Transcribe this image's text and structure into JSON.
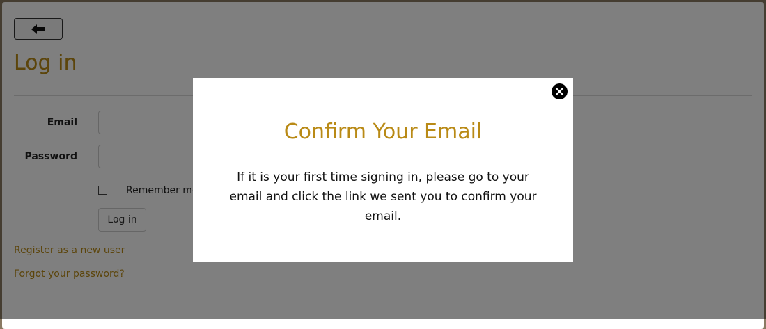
{
  "page": {
    "title": "Log in",
    "form": {
      "email_label": "Email",
      "password_label": "Password",
      "remember_label": "Remember me?",
      "login_button": "Log in"
    },
    "links": {
      "register": "Register as a new user",
      "forgot": "Forgot your password?"
    },
    "icons": {
      "back": "arrow-left-icon"
    }
  },
  "modal": {
    "title": "Confirm Your Email",
    "message": "If it is your first time signing in, please go to your email and click the link we sent you to confirm your email.",
    "icons": {
      "close": "close-icon"
    }
  },
  "colors": {
    "accent": "#b98a16",
    "overlay": "rgba(0,0,0,0.5)"
  }
}
